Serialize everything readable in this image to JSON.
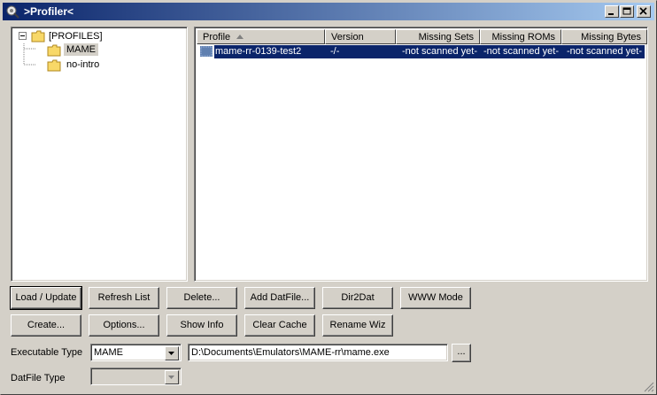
{
  "window": {
    "title": ">Profiler<",
    "buttons": {
      "minimize": "_",
      "maximize": "□",
      "close": "✕"
    }
  },
  "tree": {
    "root": {
      "label": "[PROFILES]",
      "expander": "−"
    },
    "children": [
      {
        "label": "MAME",
        "selected": true
      },
      {
        "label": "no-intro",
        "selected": false
      }
    ]
  },
  "list": {
    "columns": [
      "Profile",
      "Version",
      "Missing Sets",
      "Missing ROMs",
      "Missing Bytes"
    ],
    "rows": [
      {
        "profile": "mame-rr-0139-test2",
        "version": "-/-",
        "missing_sets": "-not scanned yet-",
        "missing_roms": "-not scanned yet-",
        "missing_bytes": "-not scanned yet-"
      }
    ]
  },
  "buttons": {
    "row1": [
      "Load / Update",
      "Refresh List",
      "Delete...",
      "Add DatFile...",
      "Dir2Dat",
      "WWW Mode"
    ],
    "row2": [
      "Create...",
      "Options...",
      "Show Info",
      "Clear Cache",
      "Rename Wiz"
    ]
  },
  "executable": {
    "label": "Executable Type",
    "type_value": "MAME",
    "path": "D:\\Documents\\Emulators\\MAME-rr\\mame.exe",
    "browse_label": "..."
  },
  "datfile": {
    "label": "DatFile Type",
    "value": ""
  },
  "colors": {
    "title_start": "#0a246a",
    "title_end": "#a6caf0",
    "selection": "#0a246a",
    "face": "#d4d0c8"
  }
}
